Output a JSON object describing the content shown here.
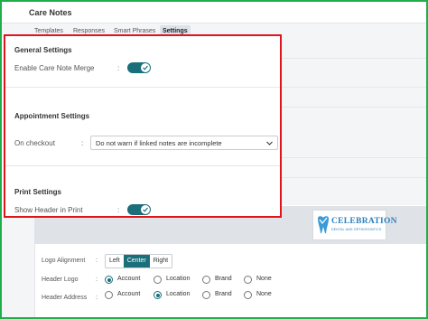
{
  "header": {
    "title": "Care Notes"
  },
  "tabs": [
    {
      "label": "Templates"
    },
    {
      "label": "Responses"
    },
    {
      "label": "Smart Phrases"
    },
    {
      "label": "Settings",
      "active": true
    }
  ],
  "general": {
    "title": "General Settings",
    "merge_label": "Enable Care Note Merge",
    "merge_on": true
  },
  "appointment": {
    "title": "Appointment Settings",
    "checkout_label": "On checkout",
    "checkout_value": "Do not warn if linked notes are incomplete"
  },
  "print": {
    "title": "Print Settings",
    "show_header_label": "Show Header in Print",
    "show_header_on": true,
    "logo": {
      "name": "CELEBRATION",
      "tagline": "DENTAL AND ORTHODONTICS"
    },
    "logo_alignment": {
      "label": "Logo Alignment",
      "options": [
        "Left",
        "Center",
        "Right"
      ],
      "selected": "Center"
    },
    "header_logo": {
      "label": "Header Logo",
      "options": [
        "Account",
        "Location",
        "Brand",
        "None"
      ],
      "selected": "Account"
    },
    "header_address": {
      "label": "Header Address",
      "options": [
        "Account",
        "Location",
        "Brand",
        "None"
      ],
      "selected": "Location"
    }
  },
  "colon": ":",
  "colors": {
    "accent": "#1a6f7a",
    "highlight_border": "#e1141c",
    "frame": "#1fae4a"
  }
}
